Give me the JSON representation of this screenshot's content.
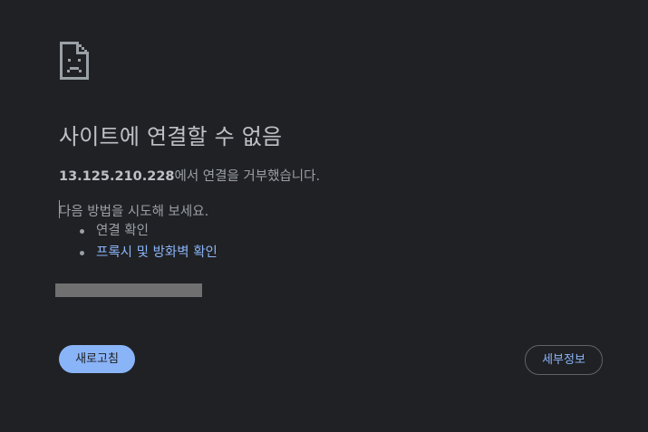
{
  "error": {
    "icon": "sad-page-icon",
    "title": "사이트에 연결할 수 없음",
    "host": "13.125.210.228",
    "message_suffix": "에서 연결을 거부했습니다.",
    "suggest_intro": "다음 방법을 시도해 보세요.",
    "suggestions": [
      {
        "label": "연결 확인",
        "is_link": false
      },
      {
        "label": "프록시 및 방화벽 확인",
        "is_link": true
      }
    ]
  },
  "buttons": {
    "reload_label": "새로고침",
    "details_label": "세부정보"
  },
  "colors": {
    "background": "#202124",
    "title": "#bdc1c6",
    "text": "#9aa0a6",
    "link": "#8ab4f8",
    "primary_button": "#8ab4f8",
    "error_code_bar": "#707070"
  }
}
